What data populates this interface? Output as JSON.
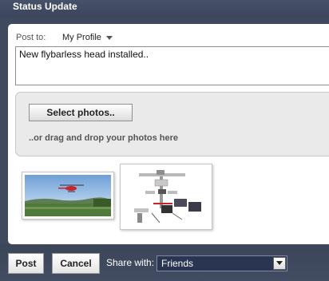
{
  "header": {
    "title": "Status Update"
  },
  "composer": {
    "post_to_label": "Post to:",
    "profile": "My Profile",
    "status_text": "New flybarless head installed.."
  },
  "photos": {
    "select_label": "Select photos..",
    "drag_hint": "..or drag and drop your photos here",
    "thumbnails": [
      {
        "subject": "helicopter in flight over field"
      },
      {
        "subject": "flybarless rotor head assembly with electronics"
      }
    ]
  },
  "footer": {
    "post_label": "Post",
    "cancel_label": "Cancel",
    "share_label": "Share with:",
    "share_value": "Friends"
  },
  "colors": {
    "background": "#3f4a5f",
    "select_background": "#2a3552",
    "panel": "#ffffff",
    "dropzone": "#eaeaea"
  }
}
